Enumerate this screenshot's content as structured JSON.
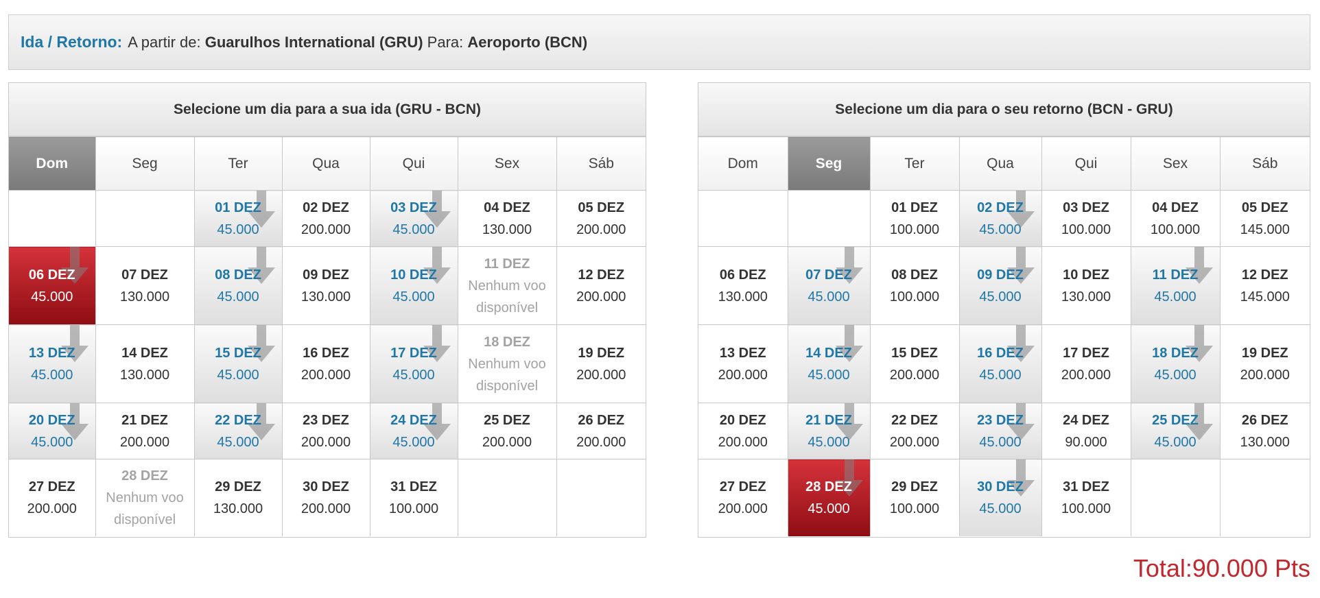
{
  "route": {
    "label": "Ida / Retorno:",
    "from_prefix": "A partir de:",
    "from": "Guarulhos International (GRU)",
    "to_prefix": "Para:",
    "to": "Aeroporto (BCN)"
  },
  "weekdays": [
    "Dom",
    "Seg",
    "Ter",
    "Qua",
    "Qui",
    "Sex",
    "Sáb"
  ],
  "outbound": {
    "title": "Selecione um dia para a sua ida (GRU - BCN)",
    "selected_weekday": 0,
    "weeks": [
      [
        null,
        null,
        {
          "date": "01 DEZ",
          "price": "45.000",
          "state": "cheap"
        },
        {
          "date": "02 DEZ",
          "price": "200.000",
          "state": "normal"
        },
        {
          "date": "03 DEZ",
          "price": "45.000",
          "state": "cheap"
        },
        {
          "date": "04 DEZ",
          "price": "130.000",
          "state": "normal"
        },
        {
          "date": "05 DEZ",
          "price": "200.000",
          "state": "normal"
        }
      ],
      [
        {
          "date": "06 DEZ",
          "price": "45.000",
          "state": "selected"
        },
        {
          "date": "07 DEZ",
          "price": "130.000",
          "state": "normal"
        },
        {
          "date": "08 DEZ",
          "price": "45.000",
          "state": "cheap"
        },
        {
          "date": "09 DEZ",
          "price": "130.000",
          "state": "normal"
        },
        {
          "date": "10 DEZ",
          "price": "45.000",
          "state": "cheap"
        },
        {
          "date": "11 DEZ",
          "price": "Nenhum voo disponível",
          "state": "unavailable"
        },
        {
          "date": "12 DEZ",
          "price": "200.000",
          "state": "normal"
        }
      ],
      [
        {
          "date": "13 DEZ",
          "price": "45.000",
          "state": "cheap"
        },
        {
          "date": "14 DEZ",
          "price": "130.000",
          "state": "normal"
        },
        {
          "date": "15 DEZ",
          "price": "45.000",
          "state": "cheap"
        },
        {
          "date": "16 DEZ",
          "price": "200.000",
          "state": "normal"
        },
        {
          "date": "17 DEZ",
          "price": "45.000",
          "state": "cheap"
        },
        {
          "date": "18 DEZ",
          "price": "Nenhum voo disponível",
          "state": "unavailable"
        },
        {
          "date": "19 DEZ",
          "price": "200.000",
          "state": "normal"
        }
      ],
      [
        {
          "date": "20 DEZ",
          "price": "45.000",
          "state": "cheap"
        },
        {
          "date": "21 DEZ",
          "price": "200.000",
          "state": "normal"
        },
        {
          "date": "22 DEZ",
          "price": "45.000",
          "state": "cheap"
        },
        {
          "date": "23 DEZ",
          "price": "200.000",
          "state": "normal"
        },
        {
          "date": "24 DEZ",
          "price": "45.000",
          "state": "cheap"
        },
        {
          "date": "25 DEZ",
          "price": "200.000",
          "state": "normal"
        },
        {
          "date": "26 DEZ",
          "price": "200.000",
          "state": "normal"
        }
      ],
      [
        {
          "date": "27 DEZ",
          "price": "200.000",
          "state": "normal"
        },
        {
          "date": "28 DEZ",
          "price": "Nenhum voo disponível",
          "state": "unavailable"
        },
        {
          "date": "29 DEZ",
          "price": "130.000",
          "state": "normal"
        },
        {
          "date": "30 DEZ",
          "price": "200.000",
          "state": "normal"
        },
        {
          "date": "31 DEZ",
          "price": "100.000",
          "state": "normal"
        },
        null,
        null
      ]
    ]
  },
  "return": {
    "title": "Selecione um dia para o seu retorno (BCN - GRU)",
    "selected_weekday": 1,
    "weeks": [
      [
        null,
        null,
        {
          "date": "01 DEZ",
          "price": "100.000",
          "state": "normal"
        },
        {
          "date": "02 DEZ",
          "price": "45.000",
          "state": "cheap"
        },
        {
          "date": "03 DEZ",
          "price": "100.000",
          "state": "normal"
        },
        {
          "date": "04 DEZ",
          "price": "100.000",
          "state": "normal"
        },
        {
          "date": "05 DEZ",
          "price": "145.000",
          "state": "normal"
        }
      ],
      [
        {
          "date": "06 DEZ",
          "price": "130.000",
          "state": "normal"
        },
        {
          "date": "07 DEZ",
          "price": "45.000",
          "state": "cheap"
        },
        {
          "date": "08 DEZ",
          "price": "100.000",
          "state": "normal"
        },
        {
          "date": "09 DEZ",
          "price": "45.000",
          "state": "cheap"
        },
        {
          "date": "10 DEZ",
          "price": "130.000",
          "state": "normal"
        },
        {
          "date": "11 DEZ",
          "price": "45.000",
          "state": "cheap"
        },
        {
          "date": "12 DEZ",
          "price": "145.000",
          "state": "normal"
        }
      ],
      [
        {
          "date": "13 DEZ",
          "price": "200.000",
          "state": "normal"
        },
        {
          "date": "14 DEZ",
          "price": "45.000",
          "state": "cheap"
        },
        {
          "date": "15 DEZ",
          "price": "200.000",
          "state": "normal"
        },
        {
          "date": "16 DEZ",
          "price": "45.000",
          "state": "cheap"
        },
        {
          "date": "17 DEZ",
          "price": "200.000",
          "state": "normal"
        },
        {
          "date": "18 DEZ",
          "price": "45.000",
          "state": "cheap"
        },
        {
          "date": "19 DEZ",
          "price": "200.000",
          "state": "normal"
        }
      ],
      [
        {
          "date": "20 DEZ",
          "price": "200.000",
          "state": "normal"
        },
        {
          "date": "21 DEZ",
          "price": "45.000",
          "state": "cheap"
        },
        {
          "date": "22 DEZ",
          "price": "200.000",
          "state": "normal"
        },
        {
          "date": "23 DEZ",
          "price": "45.000",
          "state": "cheap"
        },
        {
          "date": "24 DEZ",
          "price": "90.000",
          "state": "normal"
        },
        {
          "date": "25 DEZ",
          "price": "45.000",
          "state": "cheap"
        },
        {
          "date": "26 DEZ",
          "price": "130.000",
          "state": "normal"
        }
      ],
      [
        {
          "date": "27 DEZ",
          "price": "200.000",
          "state": "normal"
        },
        {
          "date": "28 DEZ",
          "price": "45.000",
          "state": "selected"
        },
        {
          "date": "29 DEZ",
          "price": "100.000",
          "state": "normal"
        },
        {
          "date": "30 DEZ",
          "price": "45.000",
          "state": "cheap"
        },
        {
          "date": "31 DEZ",
          "price": "100.000",
          "state": "normal"
        },
        null,
        null
      ]
    ]
  },
  "total": {
    "label": "Total:",
    "value": "90.000",
    "unit": "Pts"
  },
  "colors": {
    "accent_blue": "#1f77a8",
    "selected_red": "#c1272d",
    "unavailable_gray": "#a3a3a3"
  },
  "icons": {
    "cheap_marker": "down-arrow-icon"
  }
}
